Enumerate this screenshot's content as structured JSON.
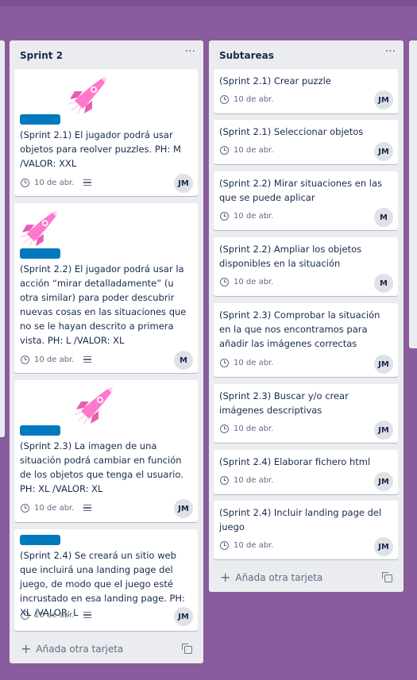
{
  "board": {
    "background": "#895d9d"
  },
  "lists": [
    {
      "title": "Sprint 2",
      "menu": "···",
      "add_card": "Añada otra tarjeta",
      "cards": [
        {
          "title": "(Sprint 2.1) El jugador podrá usar objetos para reolver puzzles. PH: M /VALOR: XXL",
          "date": "10 de abr.",
          "avatar": "JM"
        },
        {
          "title": "(Sprint 2.2) El jugador podrá usar la acción “mirar detalladamente” (u otra similar) para poder descubrir nuevas cosas en las situaciones que no se le hayan descrito a primera vista. PH: L /VALOR: XL",
          "date": "10 de abr.",
          "avatar": "M"
        },
        {
          "title": "(Sprint 2.3) La imagen de una situación podrá cambiar en función de los objetos que tenga el usuario. PH: XL /VALOR: XL",
          "date": "10 de abr.",
          "avatar": "JM"
        },
        {
          "title": "(Sprint 2.4) Se creará un sitio web que incluirá una landing page del juego, de modo que el juego esté incrustado en esa landing page. PH: XL /VALOR: L",
          "date": "10 de abr.",
          "avatar": "JM"
        }
      ]
    },
    {
      "title": "Subtareas",
      "menu": "···",
      "add_card": "Añada otra tarjeta",
      "cards": [
        {
          "title": "(Sprint 2.1) Crear puzzle",
          "date": "10 de abr.",
          "avatar": "JM"
        },
        {
          "title": "(Sprint 2.1) Seleccionar objetos",
          "date": "10 de abr.",
          "avatar": "JM"
        },
        {
          "title": "(Sprint 2.2) Mirar situaciones en las que se puede aplicar",
          "date": "10 de abr.",
          "avatar": "M"
        },
        {
          "title": "(Sprint 2.2) Ampliar los objetos disponibles en la situación",
          "date": "10 de abr.",
          "avatar": "M"
        },
        {
          "title": "(Sprint 2.3) Comprobar la situación en la que nos encontramos para añadir las imágenes correctas",
          "date": "10 de abr.",
          "avatar": "JM"
        },
        {
          "title": "(Sprint 2.3) Buscar y/o crear imágenes descriptivas",
          "date": "10 de abr.",
          "avatar": "JM"
        },
        {
          "title": "(Sprint 2.4) Elaborar fichero html",
          "date": "10 de abr.",
          "avatar": "JM"
        },
        {
          "title": "(Sprint 2.4) Incluir landing page del juego",
          "date": "10 de abr.",
          "avatar": "JM"
        }
      ]
    }
  ],
  "colors": {
    "label_blue": "#0079bf",
    "rocket_pink": "#ff78cb"
  }
}
